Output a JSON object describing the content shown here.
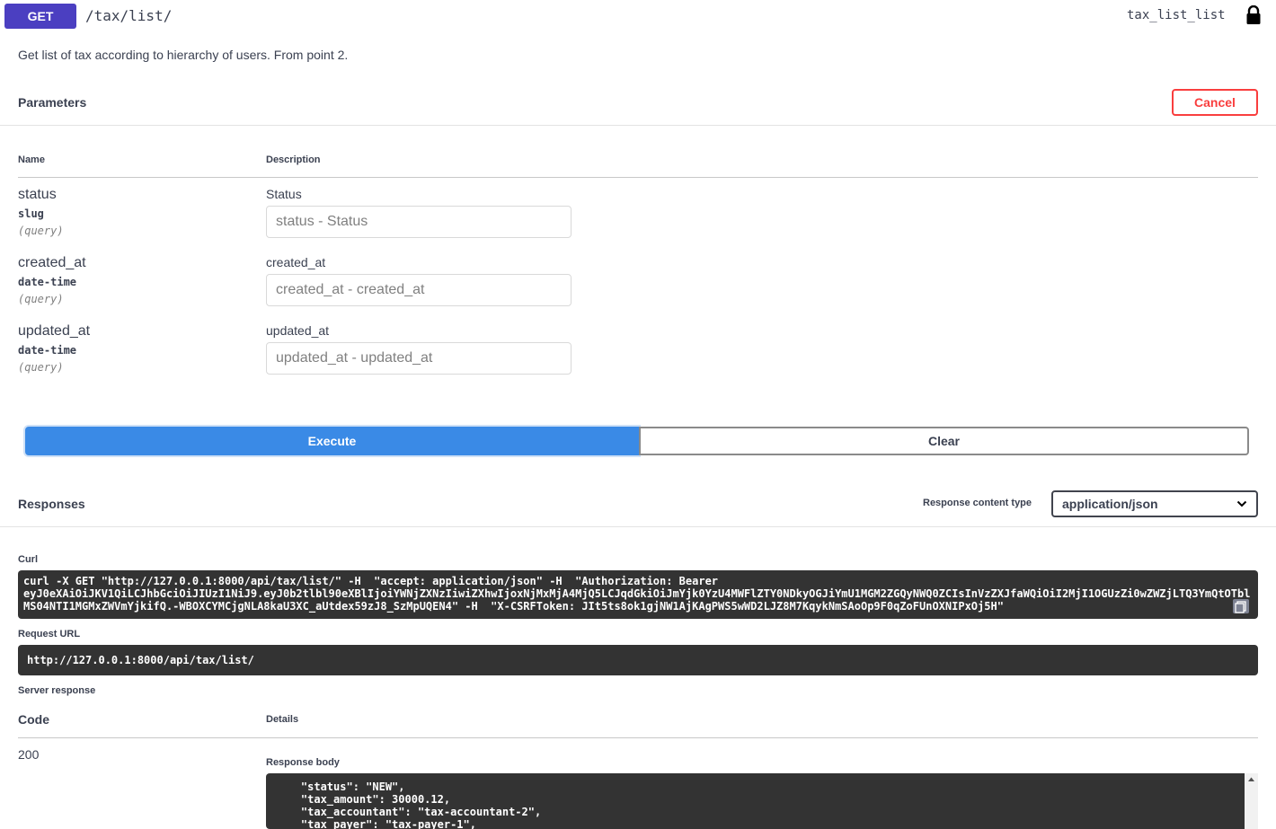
{
  "operation": {
    "method": "GET",
    "path": "/tax/list/",
    "operation_id": "tax_list_list",
    "summary": "Get list of tax according to hierarchy of users. From point 2."
  },
  "parameters": {
    "title": "Parameters",
    "cancel_label": "Cancel",
    "col_name": "Name",
    "col_description": "Description",
    "items": [
      {
        "name": "status",
        "type": "slug",
        "in": "(query)",
        "description": "Status",
        "placeholder": "status - Status"
      },
      {
        "name": "created_at",
        "type": "date-time",
        "in": "(query)",
        "description": "created_at",
        "placeholder": "created_at - created_at"
      },
      {
        "name": "updated_at",
        "type": "date-time",
        "in": "(query)",
        "description": "updated_at",
        "placeholder": "updated_at - updated_at"
      }
    ],
    "execute_label": "Execute",
    "clear_label": "Clear"
  },
  "responses": {
    "title": "Responses",
    "content_type_label": "Response content type",
    "content_type_value": "application/json",
    "curl_label": "Curl",
    "curl_lines": [
      "curl -X GET \"http://127.0.0.1:8000/api/tax/list/\" -H  \"accept: application/json\" -H  \"Authorization: Bearer",
      "eyJ0eXAiOiJKV1QiLCJhbGciOiJIUzI1NiJ9.eyJ0b2tlbl90eXBlIjoiYWNjZXNzIiwiZXhwIjoxNjMxMjA4MjQ5LCJqdGkiOiJmYjk0YzU4MWFlZTY0NDkyOGJiYmU1MGM2ZGQyNWQ0ZCIsInVzZXJfaWQiOiI2MjI1OGUzZi0wZWZjLTQ3YmQtOTbl",
      "MS04NTI1MGMxZWVmYjkifQ.-WBOXCYMCjgNLA8kaU3XC_aUtdex59zJ8_SzMpUQEN4\" -H  \"X-CSRFToken: JIt5ts8ok1gjNW1AjKAgPWS5wWD2LJZ8M7KqykNmSAoOp9F0qZoFUnOXNIPxOj5H\""
    ],
    "request_url_label": "Request URL",
    "request_url": "http://127.0.0.1:8000/api/tax/list/",
    "server_response_label": "Server response",
    "code_head": "Code",
    "details_head": "Details",
    "code": "200",
    "response_body_label": "Response body",
    "body_lines": [
      "    \"status\": \"NEW\",",
      "    \"tax_amount\": 30000.12,",
      "    \"tax_accountant\": \"tax-accountant-2\",",
      "    \"tax_payer\": \"tax-payer-1\","
    ]
  }
}
